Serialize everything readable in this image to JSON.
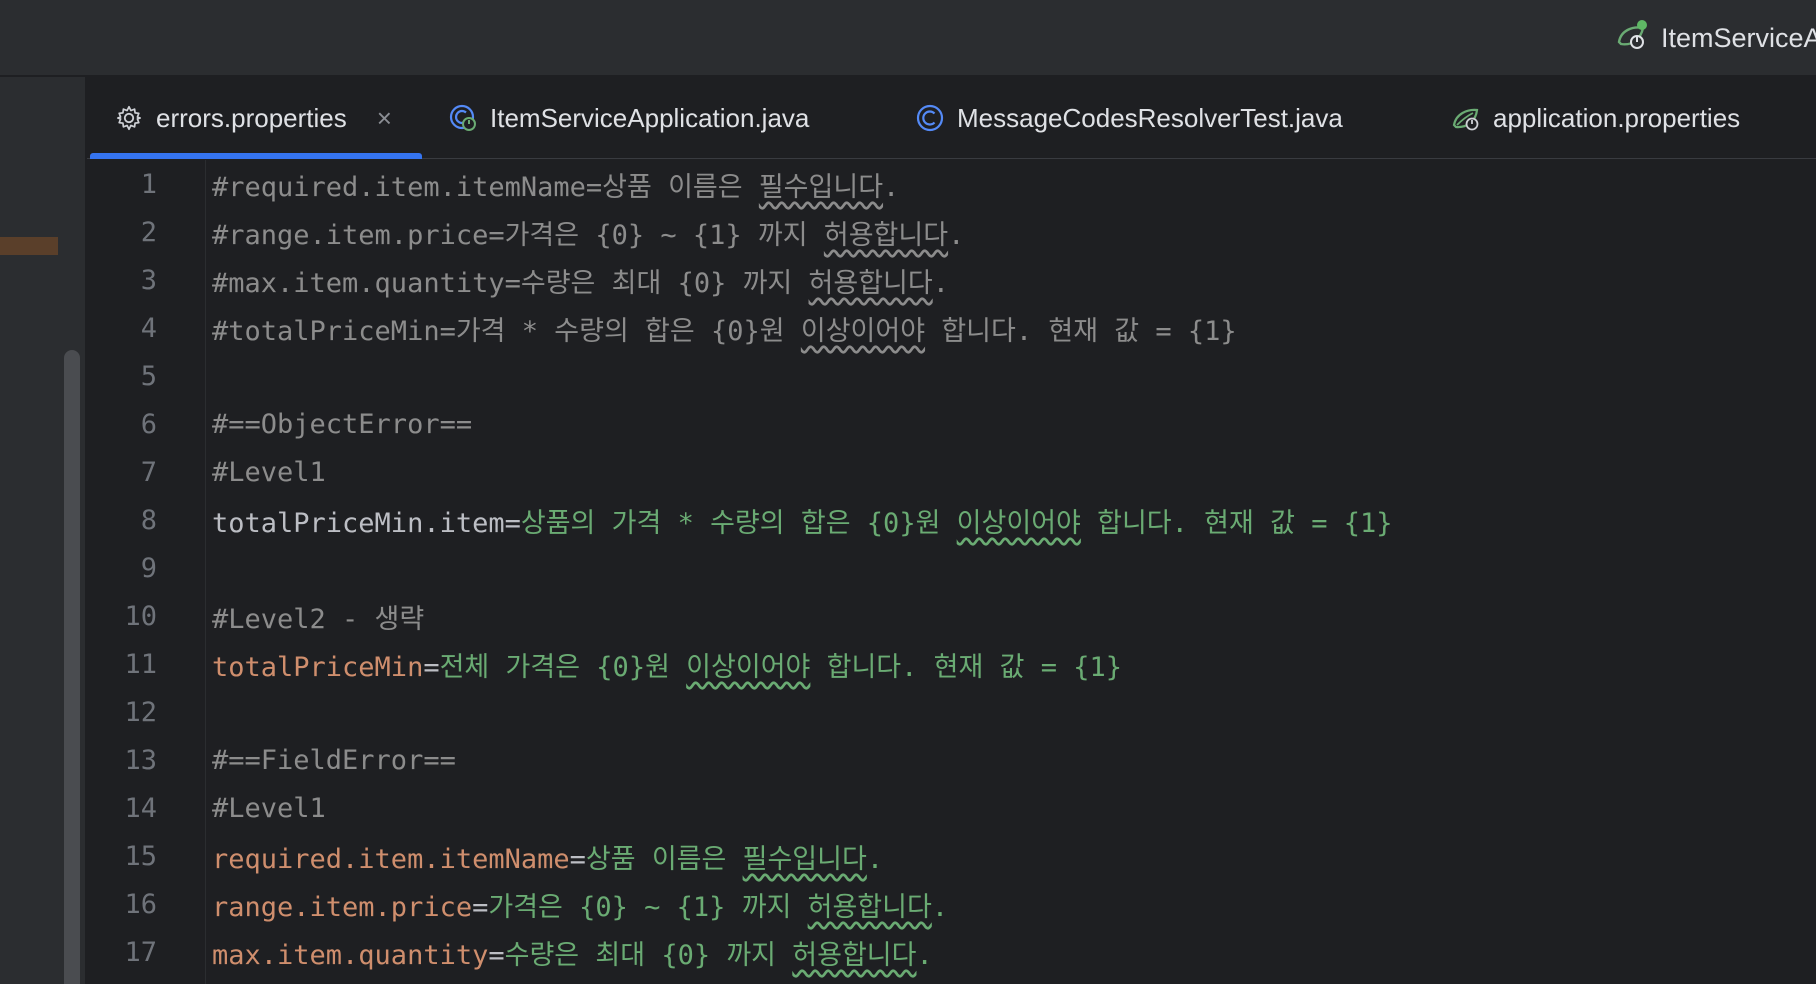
{
  "run_config": {
    "label": "ItemServiceA",
    "icon": "spring-run-icon"
  },
  "tabs": [
    {
      "label": "errors.properties",
      "icon": "gear-icon",
      "active": true,
      "close": "×"
    },
    {
      "label": "ItemServiceApplication.java",
      "icon": "spring-class-icon",
      "active": false
    },
    {
      "label": "MessageCodesResolverTest.java",
      "icon": "class-icon",
      "active": false
    },
    {
      "label": "application.properties",
      "icon": "spring-leaf-icon",
      "active": false
    }
  ],
  "editor": {
    "lines": [
      {
        "num": "1",
        "type": "comment",
        "a": "#required.item.itemName=상품 이름은 ",
        "b": "필수입니다",
        "c": "."
      },
      {
        "num": "2",
        "type": "comment",
        "a": "#range.item.price=가격은 {0} ~ {1} 까지 ",
        "b": "허용합니다",
        "c": "."
      },
      {
        "num": "3",
        "type": "comment",
        "a": "#max.item.quantity=수량은 최대 {0} 까지 ",
        "b": "허용합니다",
        "c": "."
      },
      {
        "num": "4",
        "type": "comment",
        "a": "#totalPriceMin=가격 * 수량의 합은 {0}원 ",
        "b": "이상이어야",
        "c": " 합니다. 현재 값 = {1}"
      },
      {
        "num": "5",
        "type": "blank"
      },
      {
        "num": "6",
        "type": "comment",
        "a": "#==ObjectError==",
        "b": "",
        "c": ""
      },
      {
        "num": "7",
        "type": "comment",
        "a": "#Level1",
        "b": "",
        "c": ""
      },
      {
        "num": "8",
        "type": "prop",
        "style": "dim",
        "key": "totalPriceMin.item",
        "eq": "=",
        "a": "상품의 가격 * 수량의 합은 {0}원 ",
        "b": "이상이어야",
        "c": " 합니다. 현재 값 = {1}"
      },
      {
        "num": "9",
        "type": "blank"
      },
      {
        "num": "10",
        "type": "comment",
        "a": "#Level2 - 생략",
        "b": "",
        "c": ""
      },
      {
        "num": "11",
        "type": "prop",
        "style": "key",
        "key": "totalPriceMin",
        "eq": "=",
        "a": "전체 가격은 {0}원 ",
        "b": "이상이어야",
        "c": " 합니다. 현재 값 = {1}"
      },
      {
        "num": "12",
        "type": "blank"
      },
      {
        "num": "13",
        "type": "comment",
        "a": "#==FieldError==",
        "b": "",
        "c": ""
      },
      {
        "num": "14",
        "type": "comment",
        "a": "#Level1",
        "b": "",
        "c": ""
      },
      {
        "num": "15",
        "type": "prop",
        "style": "key",
        "key": "required.item.itemName",
        "eq": "=",
        "a": "상품 이름은 ",
        "b": "필수입니다",
        "c": "."
      },
      {
        "num": "16",
        "type": "prop",
        "style": "key",
        "key": "range.item.price",
        "eq": "=",
        "a": "가격은 {0} ~ {1} 까지 ",
        "b": "허용합니다",
        "c": "."
      },
      {
        "num": "17",
        "type": "prop",
        "style": "key",
        "key": "max.item.quantity",
        "eq": "=",
        "a": "수량은 최대 {0} 까지 ",
        "b": "허용합니다",
        "c": "."
      }
    ]
  },
  "colors": {
    "background": "#1e1f22",
    "panel": "#2b2d30",
    "accent": "#3574f0",
    "comment": "#8c8c8c",
    "key": "#cf8e6d",
    "value": "#6aab73"
  }
}
